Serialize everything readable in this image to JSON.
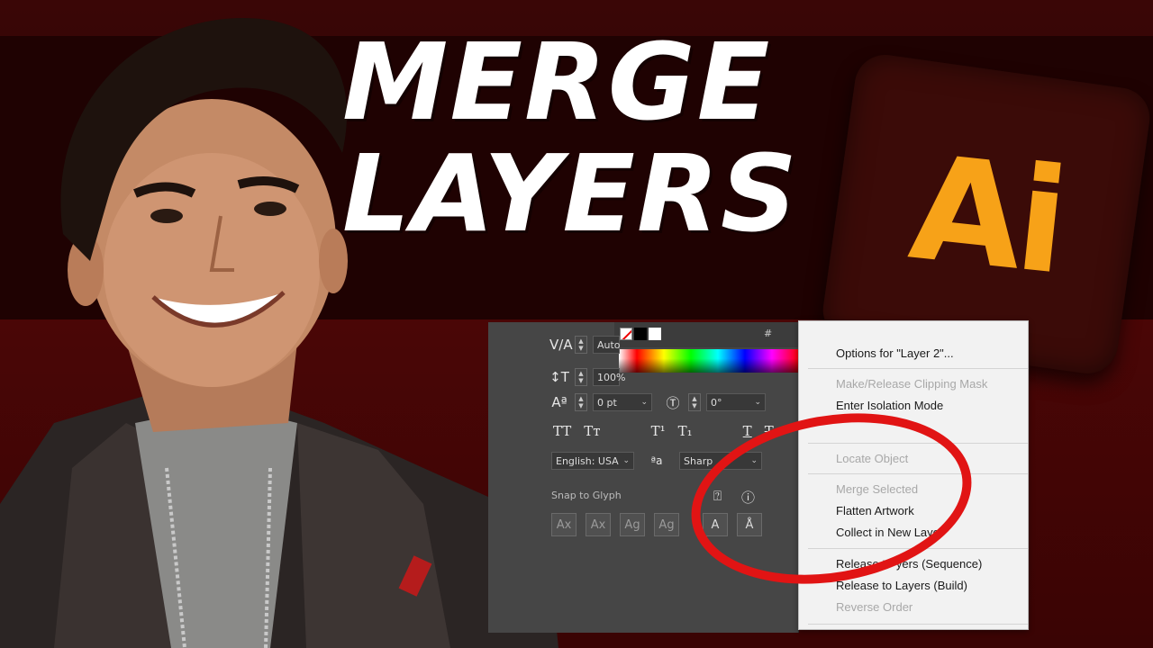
{
  "title": {
    "line1": "MERGE",
    "line2": "LAYERS"
  },
  "logo": {
    "text": "Ai",
    "bg_color": "#3b0b08",
    "fg_color": "#f7a218"
  },
  "character_panel": {
    "hex_prefix": "#",
    "tracking_value": "Auto",
    "vertical_scale_value": "100%",
    "baseline_shift_value": "0 pt",
    "rotation_value": "0°",
    "language": "English: USA",
    "antialias": "Sharp",
    "snap_to_glyph_label": "Snap to Glyph",
    "case_buttons": [
      "TT",
      "Tт",
      "T¹",
      "T₁",
      "T",
      "T"
    ],
    "snap_buttons": [
      "Ax",
      "Ax",
      "Ag",
      "Ag",
      "A",
      "Å"
    ]
  },
  "context_menu": {
    "items": [
      {
        "label": "Options for \"Layer 2\"...",
        "enabled": true
      },
      {
        "label": "Make/Release Clipping Mask",
        "enabled": false
      },
      {
        "label": "Enter Isolation Mode",
        "enabled": true
      },
      {
        "label": "Locate Object",
        "enabled": false
      },
      {
        "label": "Merge Selected",
        "enabled": false
      },
      {
        "label": "Flatten Artwork",
        "enabled": true
      },
      {
        "label": "Collect in New Laye",
        "enabled": true
      },
      {
        "label": "Release t",
        "enabled": true
      },
      {
        "label": "yers (Sequence)",
        "enabled": true
      },
      {
        "label": "Release to Layers (Build)",
        "enabled": true
      },
      {
        "label": "Reverse Order",
        "enabled": false
      }
    ]
  },
  "colors": {
    "background": "#2a0404",
    "annotation": "#e11414",
    "title": "#ffffff"
  }
}
